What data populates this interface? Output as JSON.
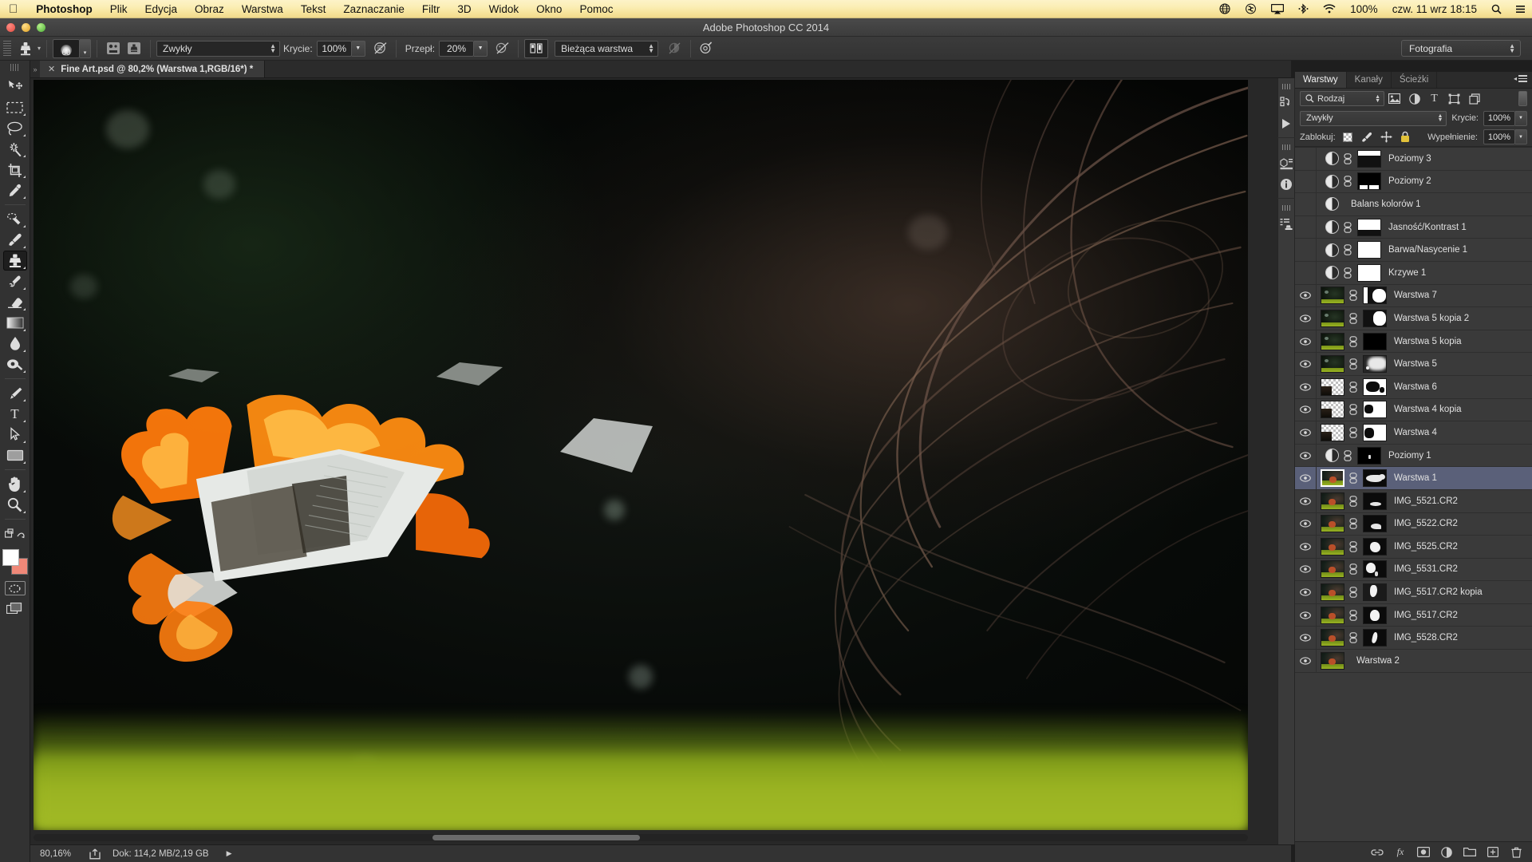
{
  "menubar": {
    "apple_icon": "apple-logo",
    "items": [
      {
        "label": "Photoshop",
        "bold": true
      },
      {
        "label": "Plik",
        "bold": false
      },
      {
        "label": "Edycja",
        "bold": false
      },
      {
        "label": "Obraz",
        "bold": false
      },
      {
        "label": "Warstwa",
        "bold": false
      },
      {
        "label": "Tekst",
        "bold": false
      },
      {
        "label": "Zaznaczanie",
        "bold": false
      },
      {
        "label": "Filtr",
        "bold": false
      },
      {
        "label": "3D",
        "bold": false
      },
      {
        "label": "Widok",
        "bold": false
      },
      {
        "label": "Okno",
        "bold": false
      },
      {
        "label": "Pomoc",
        "bold": false
      }
    ],
    "status_icons": [
      "globe-icon",
      "creative-cloud-icon",
      "airplay-icon",
      "bluetooth-icon",
      "wifi-icon",
      "search-icon",
      "menu-list-icon"
    ],
    "battery": "100%",
    "datetime": "czw. 11 wrz 18:15"
  },
  "window": {
    "title": "Adobe Photoshop CC 2014",
    "traffic_lights": [
      "close-button",
      "minimize-button",
      "zoom-button"
    ]
  },
  "options_bar": {
    "tool_icon": "clone-stamp-icon",
    "brush_size": "60",
    "brush_preset_icon": "brush-preset-icon",
    "brush_panel_icon": "brush-panel-icon",
    "clone_source_icon": "clone-source-panel-icon",
    "blend_mode": "Zwykły",
    "opacity_label": "Krycie:",
    "opacity_value": "100%",
    "opacity_pressure_icon": "pressure-opacity-icon",
    "flow_label": "Przepł:",
    "flow_value": "20%",
    "airbrush_icon": "airbrush-icon",
    "aligned_icon": "aligned-toggle-icon",
    "sample": "Bieżąca warstwa",
    "ignore_adjust_icon": "ignore-adjustment-layers-icon",
    "tablet_pressure_icon": "tablet-pressure-icon",
    "workspace": "Fotografia"
  },
  "toolbar": {
    "tools": [
      {
        "name": "move-tool",
        "glyph": "➤",
        "active": false,
        "corner": false
      },
      {
        "name": "rectangular-marquee-tool",
        "glyph": "▢",
        "active": false,
        "corner": true
      },
      {
        "name": "lasso-tool",
        "glyph": "◯",
        "active": false,
        "corner": true
      },
      {
        "name": "magic-wand-tool",
        "glyph": "✳",
        "active": false,
        "corner": true
      },
      {
        "name": "crop-tool",
        "glyph": "⌗",
        "active": false,
        "corner": true
      },
      {
        "name": "eyedropper-tool",
        "glyph": "⚲",
        "active": false,
        "corner": true
      },
      {
        "name": "spot-healing-brush-tool",
        "glyph": "✎",
        "active": false,
        "corner": true
      },
      {
        "name": "brush-tool",
        "glyph": "🖌",
        "active": false,
        "corner": true
      },
      {
        "name": "clone-stamp-tool",
        "glyph": "⌶",
        "active": true,
        "corner": true
      },
      {
        "name": "history-brush-tool",
        "glyph": "↯",
        "active": false,
        "corner": true
      },
      {
        "name": "eraser-tool",
        "glyph": "▰",
        "active": false,
        "corner": true
      },
      {
        "name": "gradient-tool",
        "glyph": "▤",
        "active": false,
        "corner": true
      },
      {
        "name": "blur-tool",
        "glyph": "💧",
        "active": false,
        "corner": true
      },
      {
        "name": "dodge-tool",
        "glyph": "◔",
        "active": false,
        "corner": true
      },
      {
        "name": "pen-tool",
        "glyph": "✒",
        "active": false,
        "corner": true
      },
      {
        "name": "type-tool",
        "glyph": "T",
        "active": false,
        "corner": true
      },
      {
        "name": "path-selection-tool",
        "glyph": "➚",
        "active": false,
        "corner": true
      },
      {
        "name": "rectangle-tool",
        "glyph": "▭",
        "active": false,
        "corner": true
      },
      {
        "name": "hand-tool",
        "glyph": "✋",
        "active": false,
        "corner": true
      },
      {
        "name": "zoom-tool",
        "glyph": "🔍",
        "active": false,
        "corner": true
      }
    ],
    "edit_toolbar_icon": "edit-toolbar-icon",
    "foreground_color": "#ffffff",
    "background_color": "#f08878",
    "quick_mask_icon": "quick-mask-icon",
    "screen_mode_icon": "screen-mode-icon"
  },
  "document": {
    "tab_title": "Fine Art.psd @ 80,2% (Warstwa 1,RGB/16*) *",
    "close_icon": "close-tab-icon"
  },
  "status_bar": {
    "zoom": "80,16%",
    "share_icon": "share-icon",
    "doc_info": "Dok: 114,2 MB/2,19 GB",
    "expand_icon": "expand-arrow-icon"
  },
  "rail": {
    "icons": [
      "history-panel-icon",
      "actions-panel-icon",
      "3d-panel-icon",
      "info-panel-icon",
      "properties-panel-icon"
    ]
  },
  "layers_panel": {
    "tabs": [
      {
        "label": "Warstwy",
        "active": true
      },
      {
        "label": "Kanały",
        "active": false
      },
      {
        "label": "Ścieżki",
        "active": false
      }
    ],
    "menu_icon": "panel-menu-icon",
    "filter": {
      "search_icon": "search-icon",
      "kind": "Rodzaj",
      "icons": [
        "filter-pixel-icon",
        "filter-adjustment-icon",
        "filter-type-icon",
        "filter-shape-icon",
        "filter-smart-object-icon"
      ],
      "power_toggle": "filter-power-switch"
    },
    "blend_mode": "Zwykły",
    "opacity_label": "Krycie:",
    "opacity_value": "100%",
    "lock_label": "Zablokuj:",
    "lock_icons": [
      "lock-transparent-pixels-icon",
      "lock-image-pixels-icon",
      "lock-position-icon",
      "lock-all-icon"
    ],
    "fill_label": "Wypełnienie:",
    "fill_value": "100%",
    "layers": [
      {
        "name": "Poziomy 3",
        "visible": false,
        "type": "adjustment",
        "mask": "levels3",
        "linked": true,
        "selected": false
      },
      {
        "name": "Poziomy 2",
        "visible": false,
        "type": "adjustment",
        "mask": "levels2",
        "linked": true,
        "selected": false
      },
      {
        "name": "Balans kolorów 1",
        "visible": false,
        "type": "adjustment",
        "mask": null,
        "linked": false,
        "selected": false
      },
      {
        "name": "Jasność/Kontrast 1",
        "visible": false,
        "type": "adjustment",
        "mask": "bc1",
        "linked": true,
        "selected": false
      },
      {
        "name": "Barwa/Nasycenie 1",
        "visible": false,
        "type": "adjustment",
        "mask": "white",
        "linked": true,
        "selected": false
      },
      {
        "name": "Krzywe 1",
        "visible": false,
        "type": "adjustment",
        "mask": "white",
        "linked": true,
        "selected": false
      },
      {
        "name": "Warstwa 7",
        "visible": true,
        "type": "pixel",
        "mask": "m7",
        "linked": true,
        "selected": false
      },
      {
        "name": "Warstwa 5 kopia 2",
        "visible": true,
        "type": "pixel",
        "mask": "m52",
        "linked": true,
        "selected": false
      },
      {
        "name": "Warstwa 5 kopia",
        "visible": true,
        "type": "pixel",
        "mask": "black",
        "linked": true,
        "selected": false
      },
      {
        "name": "Warstwa 5",
        "visible": true,
        "type": "pixel",
        "mask": "m5",
        "linked": true,
        "selected": false
      },
      {
        "name": "Warstwa 6",
        "visible": true,
        "type": "transparent",
        "mask": "m6",
        "linked": true,
        "selected": false
      },
      {
        "name": "Warstwa 4 kopia",
        "visible": true,
        "type": "transparent",
        "mask": "m4c",
        "linked": true,
        "selected": false
      },
      {
        "name": "Warstwa 4",
        "visible": true,
        "type": "transparent",
        "mask": "m4",
        "linked": true,
        "selected": false
      },
      {
        "name": "Poziomy 1",
        "visible": true,
        "type": "adjustment",
        "mask": "tiny",
        "linked": true,
        "selected": false
      },
      {
        "name": "Warstwa 1",
        "visible": true,
        "type": "photo",
        "mask": "m1",
        "linked": true,
        "selected": true
      },
      {
        "name": "IMG_5521.CR2",
        "visible": true,
        "type": "photo",
        "mask": "m21",
        "linked": true,
        "selected": false
      },
      {
        "name": "IMG_5522.CR2",
        "visible": true,
        "type": "photo",
        "mask": "m22",
        "linked": true,
        "selected": false
      },
      {
        "name": "IMG_5525.CR2",
        "visible": true,
        "type": "photo",
        "mask": "m25",
        "linked": true,
        "selected": false
      },
      {
        "name": "IMG_5531.CR2",
        "visible": true,
        "type": "photo",
        "mask": "m31",
        "linked": true,
        "selected": false
      },
      {
        "name": "IMG_5517.CR2 kopia",
        "visible": true,
        "type": "photo",
        "mask": "m17c",
        "linked": true,
        "selected": false
      },
      {
        "name": "IMG_5517.CR2",
        "visible": true,
        "type": "photo",
        "mask": "m17",
        "linked": true,
        "selected": false
      },
      {
        "name": "IMG_5528.CR2",
        "visible": true,
        "type": "photo",
        "mask": "m28",
        "linked": true,
        "selected": false
      },
      {
        "name": "Warstwa 2",
        "visible": true,
        "type": "photo",
        "mask": null,
        "linked": false,
        "selected": false
      }
    ],
    "footer_icons": [
      "link-layers-icon",
      "layer-style-icon",
      "add-mask-icon",
      "new-adjustment-layer-icon",
      "new-group-icon",
      "new-layer-icon",
      "delete-layer-icon"
    ]
  },
  "colors": {
    "menubar_accent": "#f6e39a",
    "panel_bg": "#323232",
    "layer_selected": "#5a6079",
    "grass": "#9ab322",
    "flame": "#ff7a10"
  }
}
